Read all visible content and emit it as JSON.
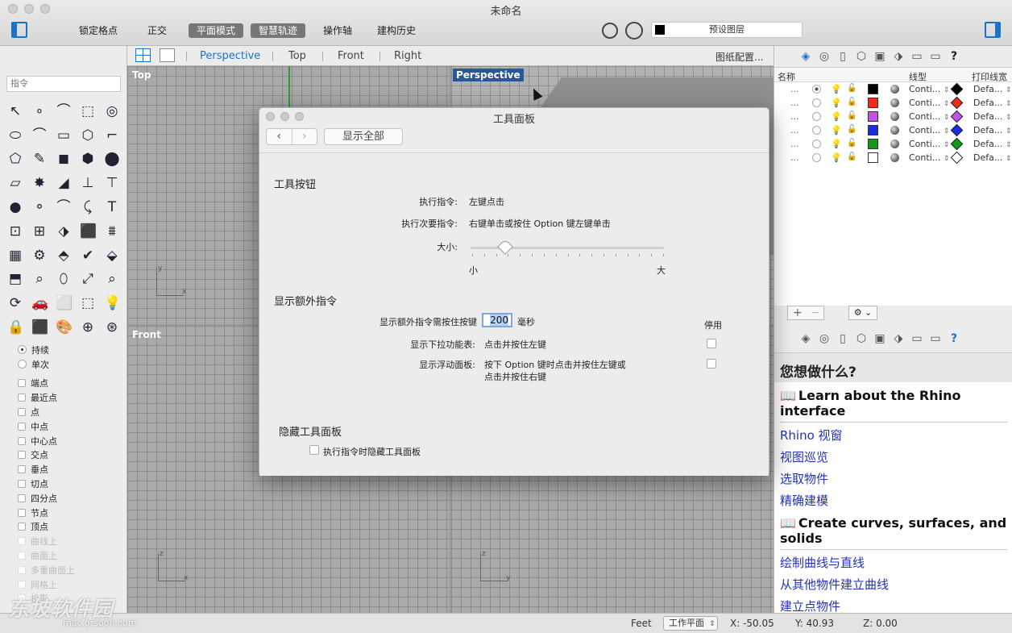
{
  "window": {
    "title": "未命名"
  },
  "toolbar": {
    "lock_grid": "锁定格点",
    "ortho": "正交",
    "planar": "平面模式",
    "smarttrack": "智慧轨迹",
    "gumball": "操作轴",
    "history": "建构历史",
    "layer_name": "预设图层"
  },
  "left": {
    "cmd_placeholder": "指令",
    "tools": [
      "↖",
      "∘",
      "⌒",
      "⬚",
      "◎",
      "⬭",
      "⌒",
      "▭",
      "⬡",
      "⌐",
      "⬠",
      "✎",
      "◼",
      "⬢",
      "⬤",
      "▱",
      "✸",
      "◢",
      "⊥",
      "⊤",
      "●",
      "⚬",
      "⌒",
      "⤹",
      "T",
      "⊡",
      "⊞",
      "⬗",
      "⬛",
      "⩩",
      "▦",
      "⚙",
      "⬘",
      "✔",
      "⬙",
      "⬒",
      "⌕",
      "⬯",
      "⤢",
      "⌕",
      "⟳",
      "🚗",
      "⬜",
      "⬚",
      "💡",
      "🔒",
      "⬛",
      "🎨",
      "⊕",
      "⊛"
    ],
    "snap_mode": {
      "persistent": "持续",
      "once": "单次"
    },
    "snaps": [
      "端点",
      "最近点",
      "点",
      "中点",
      "中心点",
      "交点",
      "垂点",
      "切点",
      "四分点",
      "节点",
      "顶点"
    ],
    "snaps_disabled": [
      "曲线上",
      "曲面上",
      "多重曲面上",
      "网格上",
      "投影"
    ]
  },
  "viewport_tabs": {
    "tabs": [
      "Perspective",
      "Top",
      "Front",
      "Right"
    ],
    "layout_btn": "图纸配置..."
  },
  "viewports": {
    "top": "Top",
    "perspective": "Perspective",
    "front": "Front",
    "axis_x": "x",
    "axis_y": "y",
    "axis_z": "z"
  },
  "layers": {
    "headers": {
      "name": "名称",
      "linetype": "线型",
      "printwidth": "打印线宽"
    },
    "rows": [
      {
        "dots": "...",
        "color": "#000000",
        "linetype": "Conti...",
        "print_color": "#000000",
        "printwidth": "Defa..."
      },
      {
        "dots": "...",
        "color": "#ee2a1a",
        "linetype": "Conti...",
        "print_color": "#ee2a1a",
        "printwidth": "Defa..."
      },
      {
        "dots": "...",
        "color": "#c552e8",
        "linetype": "Conti...",
        "print_color": "#c552e8",
        "printwidth": "Defa..."
      },
      {
        "dots": "...",
        "color": "#1a2ee0",
        "linetype": "Conti...",
        "print_color": "#1a2ee0",
        "printwidth": "Defa..."
      },
      {
        "dots": "...",
        "color": "#129a14",
        "linetype": "Conti...",
        "print_color": "#129a14",
        "printwidth": "Defa..."
      },
      {
        "dots": "...",
        "color": "#ffffff",
        "linetype": "Conti...",
        "print_color": "#ffffff",
        "printwidth": "Defa..."
      }
    ],
    "add": "+",
    "remove": "−",
    "gear": "⚙ ⌄"
  },
  "help": {
    "title": "您想做什么?",
    "section1": "Learn about the Rhino interface",
    "links1": [
      "Rhino 视窗",
      "视图巡览",
      "选取物件",
      "精确建模"
    ],
    "section2": "Create curves, surfaces, and solids",
    "links2": [
      "绘制曲线与直线",
      "从其他物件建立曲线",
      "建立点物件"
    ]
  },
  "status": {
    "units": "Feet",
    "cplane": "工作平面",
    "x": "X: -50.05",
    "y": "Y: 40.93",
    "z": "Z: 0.00"
  },
  "watermark": {
    "text": "东坡软件园",
    "url": "mac.orsoon.com"
  },
  "dialog": {
    "title": "工具面板",
    "back": "‹",
    "forward": "›",
    "show_all": "显示全部",
    "section_buttons": "工具按钮",
    "exec_label": "执行指令:",
    "exec_value": "左键点击",
    "exec2_label": "执行次要指令:",
    "exec2_value": "右键单击或按住 Option 键左键单击",
    "size_label": "大小:",
    "size_min": "小",
    "size_max": "大",
    "size_value": 0.18,
    "section_extra": "显示额外指令",
    "disabled_header": "停用",
    "hold_label": "显示额外指令需按住按键",
    "hold_value": "200",
    "hold_unit": "毫秒",
    "dropdown_label": "显示下拉功能表:",
    "dropdown_value": "点击并按住左键",
    "floating_label": "显示浮动面板:",
    "floating_value_1": "按下 Option 键时点击并按住左键或",
    "floating_value_2": "点击并按住右键",
    "section_hide": "隐藏工具面板",
    "hide_check": "执行指令时隐藏工具面板"
  }
}
